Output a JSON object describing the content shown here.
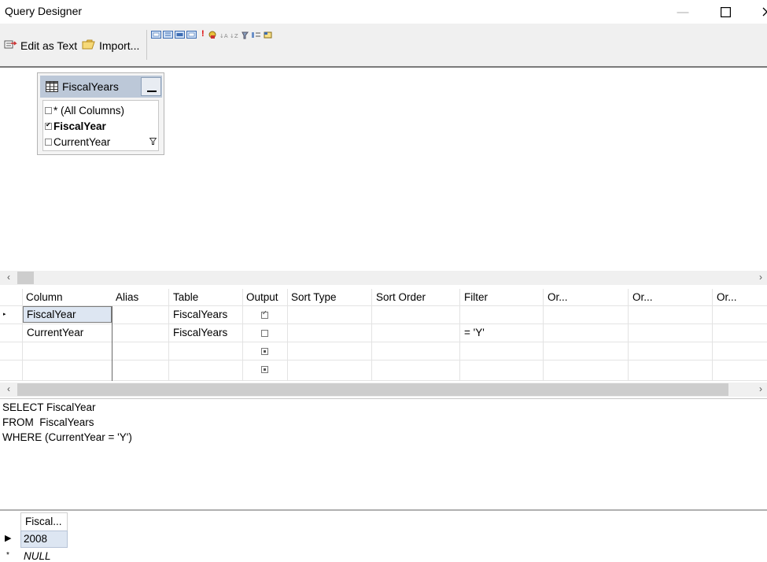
{
  "window": {
    "title": "Query Designer"
  },
  "toolbar": {
    "edit_as_text": "Edit as Text",
    "import": "Import..."
  },
  "diagram": {
    "table_name": "FiscalYears",
    "columns": [
      {
        "label": "* (All Columns)",
        "checked": false
      },
      {
        "label": "FiscalYear",
        "checked": true
      },
      {
        "label": "CurrentYear",
        "checked": false
      }
    ]
  },
  "grid": {
    "headers": [
      "Column",
      "Alias",
      "Table",
      "Output",
      "Sort Type",
      "Sort Order",
      "Filter",
      "Or...",
      "Or...",
      "Or..."
    ],
    "rows": [
      {
        "column": "FiscalYear",
        "alias": "",
        "table": "FiscalYears",
        "output": true,
        "sort_type": "",
        "sort_order": "",
        "filter": ""
      },
      {
        "column": "CurrentYear",
        "alias": "",
        "table": "FiscalYears",
        "output": false,
        "sort_type": "",
        "sort_order": "",
        "filter": "= 'Y'"
      },
      {
        "column": "",
        "alias": "",
        "table": "",
        "output": null,
        "sort_type": "",
        "sort_order": "",
        "filter": ""
      },
      {
        "column": "",
        "alias": "",
        "table": "",
        "output": null,
        "sort_type": "",
        "sort_order": "",
        "filter": ""
      }
    ]
  },
  "sql": {
    "lines": [
      "SELECT FiscalYear",
      "FROM  FiscalYears",
      "WHERE (CurrentYear = 'Y')"
    ]
  },
  "results": {
    "header": "Fiscal...",
    "values": [
      "2008"
    ],
    "new_row": "NULL"
  }
}
